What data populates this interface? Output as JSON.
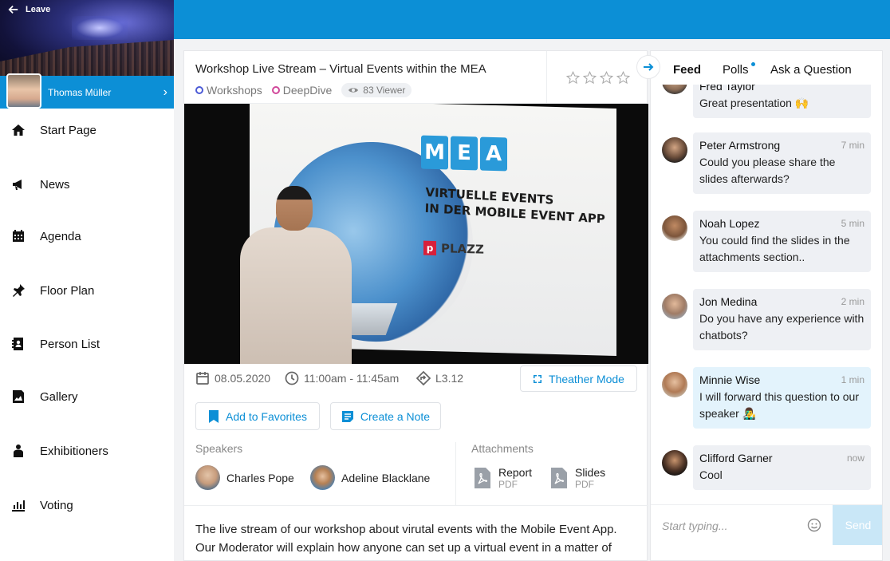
{
  "hero": {
    "leave_label": "Leave"
  },
  "user": {
    "name": "Thomas Müller"
  },
  "nav": [
    {
      "label": "Start Page",
      "icon": "home-icon"
    },
    {
      "label": "News",
      "icon": "megaphone-icon"
    },
    {
      "label": "Agenda",
      "icon": "calendar-icon"
    },
    {
      "label": "Floor Plan",
      "icon": "pin-icon"
    },
    {
      "label": "Person List",
      "icon": "contacts-icon"
    },
    {
      "label": "Gallery",
      "icon": "image-icon"
    },
    {
      "label": "Exhibitioners",
      "icon": "exhibitor-icon"
    },
    {
      "label": "Voting",
      "icon": "bar-chart-icon"
    }
  ],
  "session": {
    "title": "Workshop Live Stream – Virtual Events within the MEA",
    "tags": [
      "Workshops",
      "DeepDive"
    ],
    "viewers": "83 Viewer",
    "rating": 0,
    "date": "08.05.2020",
    "time": "11:00am - 11:45am",
    "room": "L3.12",
    "theater_label": "Theather Mode",
    "favorites_label": "Add to Favorites",
    "note_label": "Create a Note",
    "speakers_heading": "Speakers",
    "speakers": [
      "Charles Pope",
      "Adeline Blacklane"
    ],
    "attachments_heading": "Attachments",
    "attachments": [
      {
        "name": "Report",
        "type": "PDF"
      },
      {
        "name": "Slides",
        "type": "PDF"
      }
    ],
    "description": "The live stream of our workshop about virutal events with the Mobile Event App. Our Moderator will explain how anyone can set up a virtual event in a matter of"
  },
  "video": {
    "logo_letters": [
      "M",
      "E",
      "A"
    ],
    "line1": "VIRTUELLE EVENTS",
    "line2": "IN DER MOBILE EVENT APP",
    "brand": "PLAZZ"
  },
  "chat": {
    "tabs": [
      "Feed",
      "Polls",
      "Ask a Question"
    ],
    "messages": [
      {
        "name": "Fred Taylor",
        "time": "",
        "text": "Great presentation 🙌"
      },
      {
        "name": "Peter Armstrong",
        "time": "7 min",
        "text": "Could you please share the slides afterwards?"
      },
      {
        "name": "Noah Lopez",
        "time": "5 min",
        "text": "You could find the slides in the attachments section.."
      },
      {
        "name": "Jon Medina",
        "time": "2 min",
        "text": "Do you have any experience with chatbots?"
      },
      {
        "name": "Minnie Wise",
        "time": "1 min",
        "text": "I will forward this question to our speaker 👨‍🎤"
      },
      {
        "name": "Clifford Garner",
        "time": "now",
        "text": "Cool"
      }
    ],
    "input_placeholder": "Start typing...",
    "send_label": "Send"
  },
  "colors": {
    "brand": "#0c8fd6",
    "tag_workshops": "#4c5bd6",
    "tag_deepdive": "#d1479a"
  }
}
